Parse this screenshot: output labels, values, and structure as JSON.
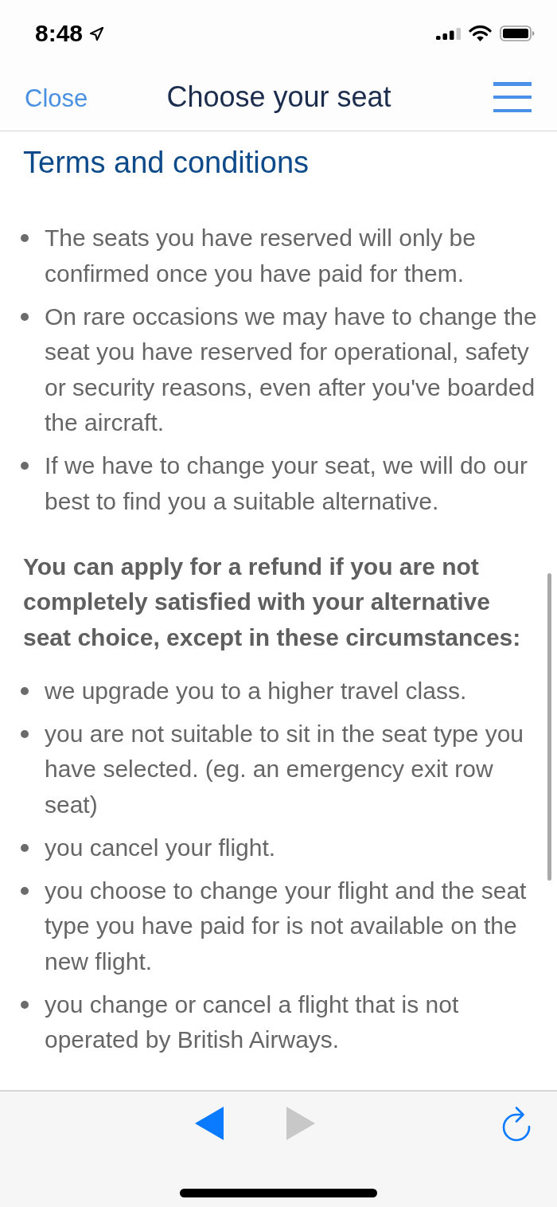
{
  "status_bar": {
    "time": "8:48"
  },
  "header": {
    "close": "Close",
    "title": "Choose your seat"
  },
  "content": {
    "heading": "Terms and conditions",
    "conditions": [
      "The seats you have reserved will only be confirmed once you have paid for them.",
      "On rare occasions we may have to change the seat you have reserved for operational, safety or security reasons, even after you've boarded the aircraft.",
      "If we have to change your seat, we will do our best to find you a suitable alternative."
    ],
    "refund_note": "You can apply for a refund if you are not completely satisfied with your alternative seat choice, except in these circumstances:",
    "exceptions": [
      "we upgrade you to a higher travel class.",
      "you are not suitable to sit in the seat type you have selected. (eg. an emergency exit row seat)",
      "you cancel your flight.",
      "you choose to change your flight and the seat type you have paid for is not available on the new flight.",
      "you change or cancel a flight that is not operated by British Airways."
    ]
  },
  "toolbar": {
    "back": {
      "disabled": false
    },
    "forward": {
      "disabled": true
    }
  }
}
